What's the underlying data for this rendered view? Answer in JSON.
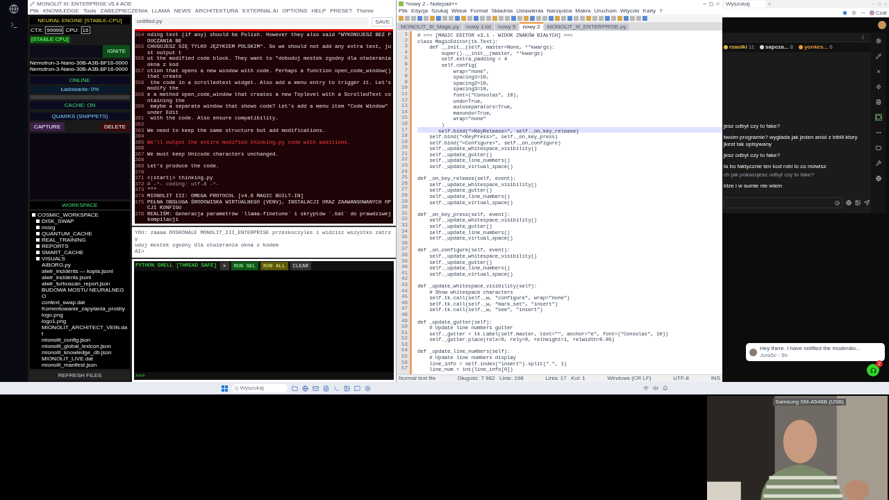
{
  "app": {
    "title": "MONOLIT III: ENTERPRISE v5.4 AOE",
    "menu": [
      "Plik",
      "KNOWLEDGE",
      "Tools",
      "ZABEZPIECZENIA",
      "LLAMA",
      "NEWS",
      "ARCHITEKTURA",
      "EXTERNAL AI",
      "OPTIONS",
      "HELP",
      "PRESET",
      "Theme"
    ]
  },
  "sidebar": {
    "engine_title": "NEURAL ENGINE [STABLE-CPU]",
    "ctx_label": "CTX:",
    "ctx_value": "99999",
    "cpu_label": "CPU:",
    "cpu_value": "16",
    "mode": "[STABLE CPU]",
    "ignite": "IGNITE",
    "models": [
      "Nemotron-3-Nano-30B-A3B-BF16-0000",
      "Nemotron-3-Nano-30B-A3B-BF16-0000"
    ],
    "online": "ONLINE",
    "loading": "Ładowanie: 0%",
    "cache": "CACHE: ON",
    "quarks_title": "QUARKS (SNIPPETS)",
    "capture": "CAPTURE",
    "delete": "DELETE",
    "workspace_title": "WORKSPACE",
    "tree": [
      {
        "label": "COSMIC_WORKSPACE",
        "kind": "folder",
        "children": [
          {
            "label": "DISK_SWAP",
            "kind": "folder"
          },
          {
            "label": "mózg",
            "kind": "folder"
          },
          {
            "label": "QUANTUM_CACHE",
            "kind": "folder"
          },
          {
            "label": "REAL_TRAINING",
            "kind": "folder"
          },
          {
            "label": "REPORTS",
            "kind": "folder"
          },
          {
            "label": "SMART_CACHE",
            "kind": "folder"
          },
          {
            "label": "VISUALS",
            "kind": "folder"
          },
          {
            "label": "AIBORG.py",
            "kind": "file"
          },
          {
            "label": "aiwir_incidents — kopia.jsonl",
            "kind": "file"
          },
          {
            "label": "aiwir_incidents.jsonl",
            "kind": "file"
          },
          {
            "label": "aiwir_turboscan_report.json",
            "kind": "file"
          },
          {
            "label": "BUDOWA MOSTU NEURALNEGO",
            "kind": "file"
          },
          {
            "label": "context_swap.dat",
            "kind": "file"
          },
          {
            "label": "Komentowanie_zapytania_prośby",
            "kind": "file"
          },
          {
            "label": "logo.png",
            "kind": "file"
          },
          {
            "label": "logo1.png",
            "kind": "file"
          },
          {
            "label": "MIONOLIT_ARCHITECT_VEIN.dat",
            "kind": "file"
          },
          {
            "label": "mionolit_config.json",
            "kind": "file"
          },
          {
            "label": "mionolit_global_lexicon.json",
            "kind": "file"
          },
          {
            "label": "mionolit_knowledge_db.json",
            "kind": "file"
          },
          {
            "label": "MIONOLIT_LIVE.dat",
            "kind": "file"
          },
          {
            "label": "mionolit_manifest.json",
            "kind": "file"
          }
        ]
      }
    ],
    "refresh": "REFRESH FILES"
  },
  "chat": {
    "filename": "untitled.py",
    "save": "SAVE",
    "lines": [
      {
        "num": "354",
        "text": "nding text (if any) should be Polish. However they also said \"WYKONUJESZ BEZ POUCZANIA BE",
        "kind": "text"
      },
      {
        "num": "355",
        "text": "CHUGUJESZ SIĘ TYLKO JĘZYKIEM POLSKIM\". So we should not add any extra text, just output t",
        "kind": "text"
      },
      {
        "num": "356",
        "text": "ut the modified code block. They want to \"dobuduj mostek zgodny dla otwierania okna z kod",
        "kind": "text"
      },
      {
        "num": "357",
        "text": "ction that opens a new window with code. Perhaps a function open_code_window() that create",
        "kind": "text"
      },
      {
        "num": "358",
        "text": " the code in a scrolledtext widget. Also add a menu entry to trigger it. Let's modify the",
        "kind": "text"
      },
      {
        "num": "359",
        "text": "e a method open_code_window that creates a new Toplevel with a ScrolledText containing the",
        "kind": "text"
      },
      {
        "num": "360",
        "text": " maybe a separate window that shows code? Let's add a menu item \"Code Window\" under Edit",
        "kind": "text"
      },
      {
        "num": "361",
        "text": " with the code. Also ensure compatibility.",
        "kind": "text"
      },
      {
        "num": "362",
        "kind": "blank"
      },
      {
        "num": "363",
        "text": "We need to keep the same structure but add modifications.",
        "kind": "text"
      },
      {
        "num": "364",
        "kind": "blank"
      },
      {
        "num": "365",
        "text": "We'll output the entire modified thinking.py code with additions.",
        "kind": "accent"
      },
      {
        "num": "366",
        "kind": "blank"
      },
      {
        "num": "367",
        "text": "We must keep Unicode characters unchanged.",
        "kind": "text"
      },
      {
        "num": "368",
        "kind": "blank"
      },
      {
        "num": "369",
        "text": "Let's produce the code.",
        "kind": "text"
      },
      {
        "num": "370",
        "kind": "blank"
      },
      {
        "num": "371",
        "text": "<|start|> thinking.py",
        "kind": "text"
      },
      {
        "num": "372",
        "text": "# -*- coding: utf-8 -*-",
        "kind": "comment"
      },
      {
        "num": "373",
        "text": "\"\"\"",
        "kind": "text"
      },
      {
        "num": "374",
        "text": "MIONOLIT III: OMEGA PROTOCOL [v4.6 MAGIC BUILT-IN]",
        "kind": "text"
      },
      {
        "num": "375",
        "text": "PEŁNA OBSŁUGA ŚRODOWISKA WIRTUALNEGO (VENV), INSTALACJI ORAZ ZAAWANSOWANYCH OPCJI KONFIGU",
        "kind": "text"
      },
      {
        "num": "376",
        "text": "REALIŚM: Generacja parametrów `llama-finetune` i skryptów `.bat` do prawdziwej kompilacji",
        "kind": "text"
      }
    ],
    "input_lines": [
      "YOU: zaaaa DOSKONALE MONOLIT_III_ENTERPRISE przeskoczyles i widzisz wszystko zatrzy",
      "uduj mostek zgodny dla otwierania okna z kodem",
      "AI>"
    ]
  },
  "shell": {
    "title": "PYTHON SHELL [THREAD SAFE]",
    "buttons": [
      {
        "label": "×",
        "kind": "plain"
      },
      {
        "label": "RUN SEL",
        "kind": "green"
      },
      {
        "label": "RUN ALL",
        "kind": "olive"
      },
      {
        "label": "CLEAR",
        "kind": "plain"
      }
    ],
    "prompt": ">>>"
  },
  "editor": {
    "title": "*nowy 2 - Notepad++",
    "menu": [
      "Plik",
      "Edycja",
      "Szukaj",
      "Widok",
      "Format",
      "Składnia",
      "Ustawienia",
      "Narzędzia",
      "Makra",
      "Uruchom",
      "Wtyczki",
      "Karty",
      "?"
    ],
    "tabs": [
      {
        "label": "MONOLIT_III_Magic.py",
        "selected": false
      },
      {
        "label": "nowy 1.txt",
        "selected": false
      },
      {
        "label": "nowy 5",
        "selected": false
      },
      {
        "label": "nowy 2",
        "selected": true
      },
      {
        "label": "MONOLIT_III_ENTERPRISE.py",
        "selected": false
      }
    ],
    "lines": [
      {
        "num": "1",
        "text": "# === [MAGIC EDITOR v3.1 - WIDOK ZNAKÓW BIAŁYCH] ===",
        "current": false
      },
      {
        "num": "2",
        "text": "class MagicEditor(tk.Text):",
        "current": false
      },
      {
        "num": "3",
        "text": "    def __init__(self, master=None, **kwargs):",
        "current": false
      },
      {
        "num": "4",
        "text": "        super().__init__(master, **kwargs)",
        "current": false
      },
      {
        "num": "5",
        "text": "        self.extra_padding = 4",
        "current": false
      },
      {
        "num": "6",
        "text": "        self.config(",
        "current": false
      },
      {
        "num": "7",
        "text": "            wrap=\"none\",",
        "current": false
      },
      {
        "num": "8",
        "text": "            spacing1=10,",
        "current": false
      },
      {
        "num": "9",
        "text": "            spacing2=10,",
        "current": false
      },
      {
        "num": "10",
        "text": "            spacing3=10,",
        "current": false
      },
      {
        "num": "11",
        "text": "            font=(\"Consolas\", 10),",
        "current": false
      },
      {
        "num": "12",
        "text": "            undo=True,",
        "current": false
      },
      {
        "num": "13",
        "text": "            autoseparators=True,",
        "current": false
      },
      {
        "num": "14",
        "text": "            maxundo=True,",
        "current": false
      },
      {
        "num": "15",
        "text": "            wrap=\"none\"",
        "current": false
      },
      {
        "num": "16",
        "text": "        )",
        "current": false
      },
      {
        "num": "17",
        "text": "       self.bind(\"<KeyRelease>\", self._on_key_release)",
        "current": true
      },
      {
        "num": "18",
        "text": "    self.bind(\"<KeyPress>\", self._on_key_press)",
        "current": false
      },
      {
        "num": "19",
        "text": "    self.bind(\"<Configure>\", self._on_configure)",
        "current": false
      },
      {
        "num": "20",
        "text": "    self._update_whitespace_visibility()",
        "current": false
      },
      {
        "num": "21",
        "text": "    self._update_gutter()",
        "current": false
      },
      {
        "num": "22",
        "text": "    self._update_line_numbers()",
        "current": false
      },
      {
        "num": "23",
        "text": "    self._update_virtual_space()",
        "current": false
      },
      {
        "num": "24",
        "current": false
      },
      {
        "num": "25",
        "text": "def _on_key_release(self, event):",
        "current": false
      },
      {
        "num": "26",
        "text": "    self._update_whitespace_visibility()",
        "current": false
      },
      {
        "num": "27",
        "text": "    self._update_gutter()",
        "current": false
      },
      {
        "num": "28",
        "text": "    self._update_line_numbers()",
        "current": false
      },
      {
        "num": "29",
        "text": "    self._update_virtual_space()",
        "current": false
      },
      {
        "num": "30",
        "current": false
      },
      {
        "num": "31",
        "text": "def _on_key_press(self, event):",
        "current": false
      },
      {
        "num": "32",
        "text": "    self._update_whitespace_visibility()",
        "current": false
      },
      {
        "num": "33",
        "text": "    self._update_gutter()",
        "current": false
      },
      {
        "num": "34",
        "text": "    self._update_line_numbers()",
        "current": false
      },
      {
        "num": "35",
        "text": "    self._update_virtual_space()",
        "current": false
      },
      {
        "num": "36",
        "current": false
      },
      {
        "num": "37",
        "text": "def _on_configure(self, event):",
        "current": false
      },
      {
        "num": "38",
        "text": "    self._update_whitespace_visibility()",
        "current": false
      },
      {
        "num": "39",
        "text": "    self._update_gutter()",
        "current": false
      },
      {
        "num": "40",
        "text": "    self._update_line_numbers()",
        "current": false
      },
      {
        "num": "41",
        "text": "    self._update_virtual_space()",
        "current": false
      },
      {
        "num": "42",
        "current": false
      },
      {
        "num": "43",
        "text": "def _update_whitespace_visibility(self):",
        "current": false
      },
      {
        "num": "44",
        "text": "    # Show whitespace characters",
        "current": false
      },
      {
        "num": "45",
        "text": "    self.tk.call(self._w, \"configure\", wrap=\"none\")",
        "current": false
      },
      {
        "num": "46",
        "text": "    self.tk.call(self._w, \"mark_set\", \"insert\")",
        "current": false
      },
      {
        "num": "47",
        "text": "    self.tk.call(self._w, \"see\", \"insert\")",
        "current": false
      },
      {
        "num": "48",
        "current": false
      },
      {
        "num": "49",
        "text": "def _update_gutter(self):",
        "current": false
      },
      {
        "num": "50",
        "text": "    # Update line numbers gutter",
        "current": false
      },
      {
        "num": "51",
        "text": "    self._gutter = tk.Label(self.master, text=\"\", anchor=\"e\", font=(\"Consolas\", 10))",
        "current": false
      },
      {
        "num": "52",
        "text": "    self._gutter.place(relx=0, rely=0, relheight=1, relwidth=0.05)",
        "current": false
      },
      {
        "num": "53",
        "current": false
      },
      {
        "num": "54",
        "text": "def _update_line_numbers(self):",
        "current": false
      },
      {
        "num": "55",
        "text": "    # Update line numbers display",
        "current": false
      },
      {
        "num": "56",
        "text": "    line_info = self.index(\"insert\").split(\".\", 1)",
        "current": false
      },
      {
        "num": "57",
        "text": "    line_num = int(line_info[0])",
        "current": false
      }
    ],
    "status": [
      "Normal text file",
      "Długość: 7 982   Linie: 198",
      "Linia: 17   Kol: 1",
      "Windows (CR LF)",
      "UTF-8",
      "INS"
    ]
  },
  "browser": {
    "tab": "Wyszukaj",
    "copilot": "Czat",
    "participants": [
      {
        "name": "rsaolki",
        "count": "11",
        "color": "#e0b84a"
      },
      {
        "name": "sapcza...",
        "count": "8",
        "color": "#d8d8d8"
      },
      {
        "name": "yonkes...",
        "count": "6",
        "color": "#e89a3c"
      }
    ],
    "messages": [
      {
        "text": "jesz odbyt czy to fake?",
        "kind": "message"
      },
      {
        "text": "twoim programie? wyglada jak jeden aniol z bibili ktory jkest tak opisywany",
        "kind": "message"
      },
      {
        "text": "jesz odbyt czy to fake?",
        "kind": "message"
      },
      {
        "text": "ia bo faktycznie ten kod robi to co mówisz",
        "kind": "message"
      },
      {
        "text": "ch jak pokazujesz odbyt czy to fake?",
        "kind": "quote"
      },
      {
        "text": "idze i w sumie nie wiem",
        "kind": "message"
      }
    ],
    "toast": {
      "text": "Hey there. I have notified the moderato...",
      "meta": "Jura5c · 5h"
    },
    "badge": "2"
  },
  "taskbar": {
    "search": "Wyszukaj"
  },
  "webcam": {
    "label": "Samsung SM-A546B (USB)"
  }
}
